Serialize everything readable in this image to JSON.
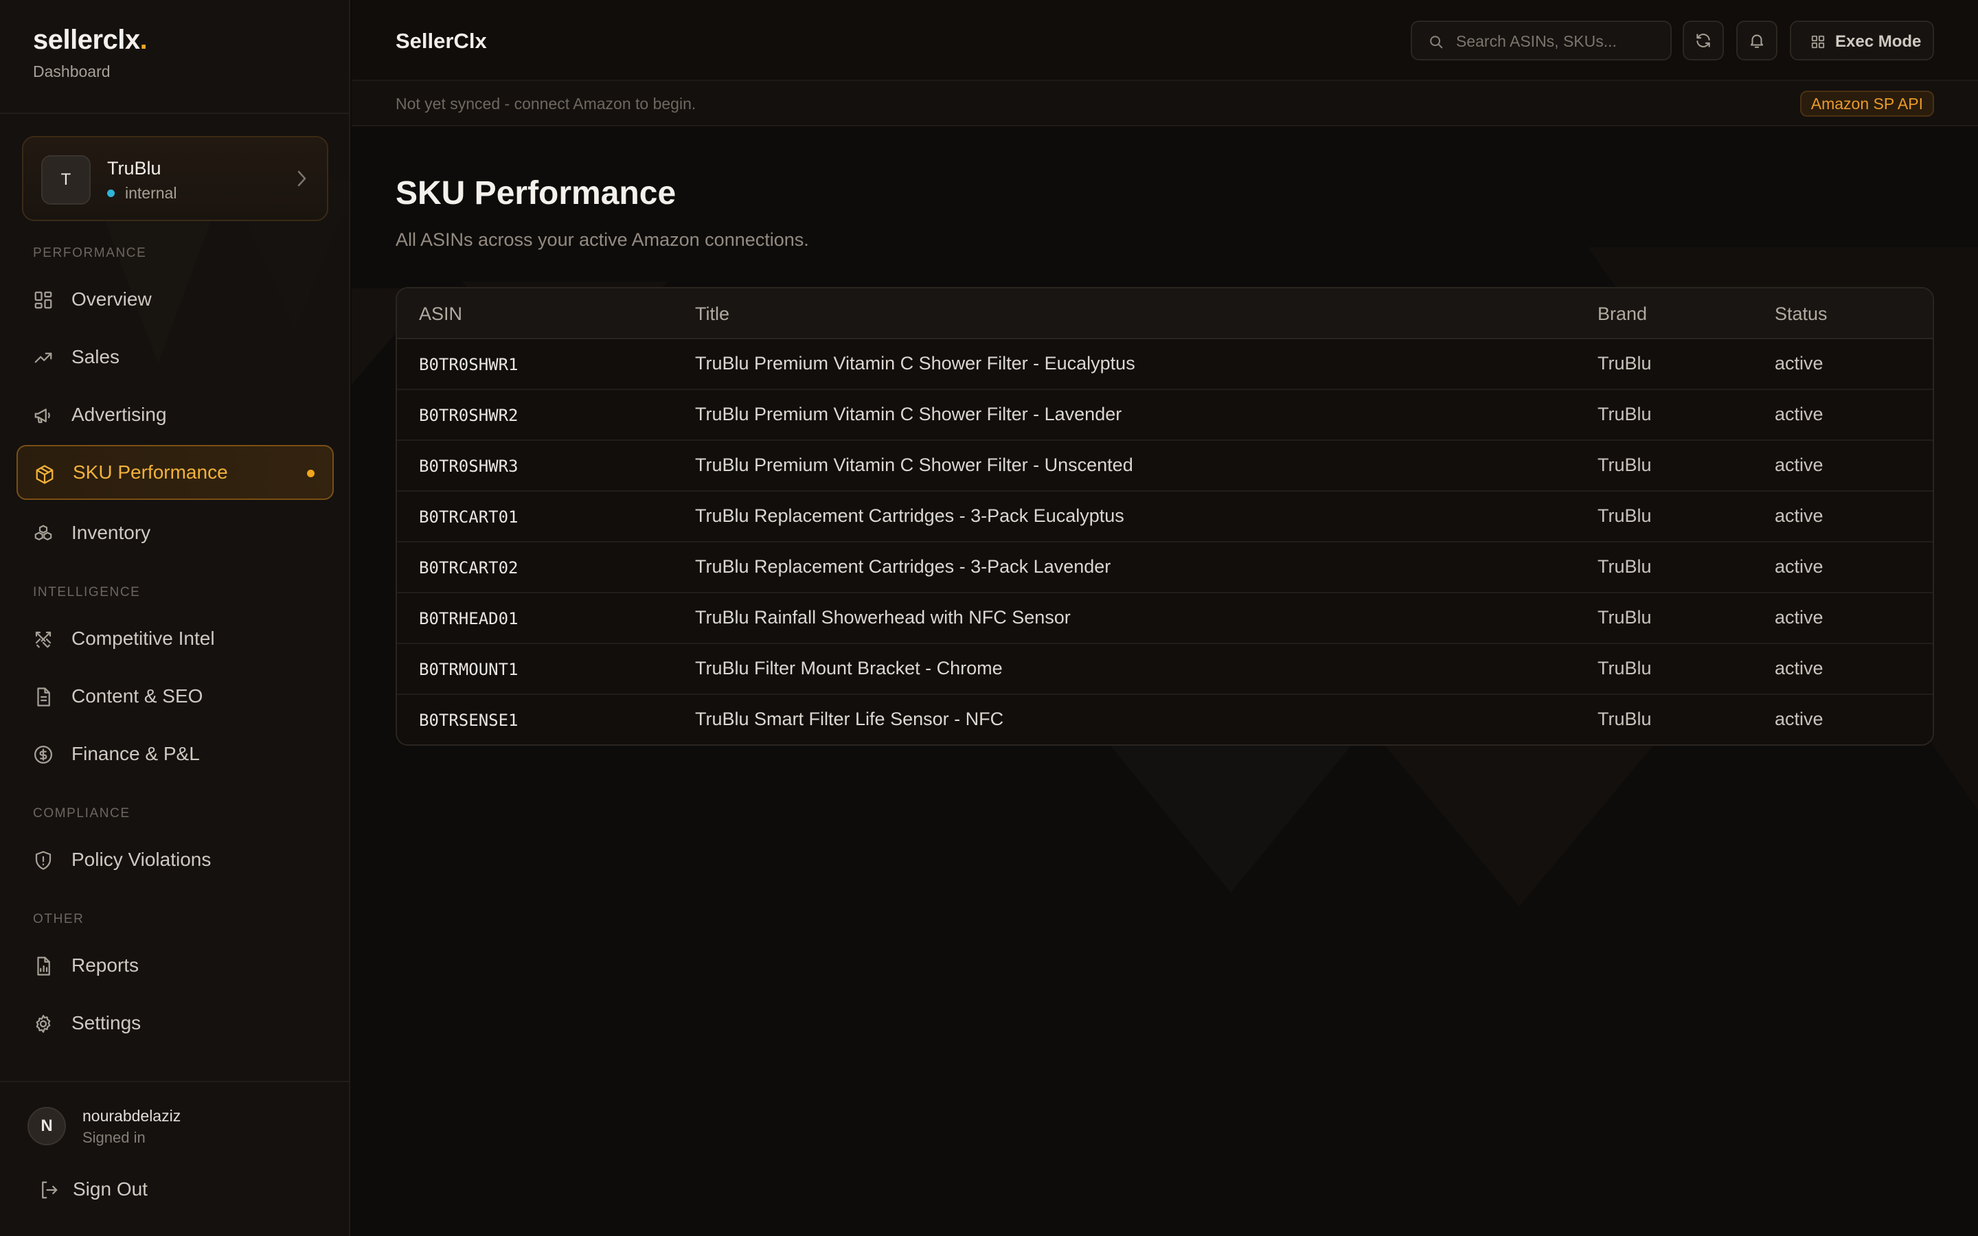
{
  "sidebar": {
    "brand": {
      "name": "sellerclx",
      "dot": ".",
      "subtitle": "Dashboard"
    },
    "org": {
      "initial": "T",
      "name": "TruBlu",
      "status": "internal"
    },
    "sections": {
      "performance": "PERFORMANCE",
      "intelligence": "INTELLIGENCE",
      "compliance": "COMPLIANCE",
      "other": "OTHER"
    },
    "items": [
      {
        "label": "Overview",
        "icon": "grid-icon"
      },
      {
        "label": "Sales",
        "icon": "trending-up-icon"
      },
      {
        "label": "Advertising",
        "icon": "megaphone-icon"
      },
      {
        "label": "SKU Performance",
        "icon": "package-icon",
        "active": true
      },
      {
        "label": "Inventory",
        "icon": "boxes-icon"
      },
      {
        "label": "Competitive Intel",
        "icon": "swords-icon"
      },
      {
        "label": "Content & SEO",
        "icon": "document-icon"
      },
      {
        "label": "Finance & P&L",
        "icon": "dollar-circle-icon"
      },
      {
        "label": "Policy Violations",
        "icon": "shield-alert-icon"
      },
      {
        "label": "Reports",
        "icon": "report-icon"
      },
      {
        "label": "Settings",
        "icon": "gear-icon"
      }
    ],
    "user": {
      "initial": "N",
      "name": "nourabdelaziz",
      "state": "Signed in"
    },
    "signout": "Sign Out"
  },
  "header": {
    "title": "SellerClx",
    "search_placeholder": "Search ASINs, SKUs...",
    "exec_mode": "Exec Mode"
  },
  "syncbar": {
    "message": "Not yet synced - connect Amazon to begin.",
    "badge": "Amazon SP API"
  },
  "page": {
    "title": "SKU Performance",
    "subtitle": "All ASINs across your active Amazon connections."
  },
  "table": {
    "columns": [
      "ASIN",
      "Title",
      "Brand",
      "Status"
    ],
    "rows": [
      {
        "asin": "B0TR0SHWR1",
        "title": "TruBlu Premium Vitamin C Shower Filter - Eucalyptus",
        "brand": "TruBlu",
        "status": "active"
      },
      {
        "asin": "B0TR0SHWR2",
        "title": "TruBlu Premium Vitamin C Shower Filter - Lavender",
        "brand": "TruBlu",
        "status": "active"
      },
      {
        "asin": "B0TR0SHWR3",
        "title": "TruBlu Premium Vitamin C Shower Filter - Unscented",
        "brand": "TruBlu",
        "status": "active"
      },
      {
        "asin": "B0TRCART01",
        "title": "TruBlu Replacement Cartridges - 3-Pack Eucalyptus",
        "brand": "TruBlu",
        "status": "active"
      },
      {
        "asin": "B0TRCART02",
        "title": "TruBlu Replacement Cartridges - 3-Pack Lavender",
        "brand": "TruBlu",
        "status": "active"
      },
      {
        "asin": "B0TRHEAD01",
        "title": "TruBlu Rainfall Showerhead with NFC Sensor",
        "brand": "TruBlu",
        "status": "active"
      },
      {
        "asin": "B0TRMOUNT1",
        "title": "TruBlu Filter Mount Bracket - Chrome",
        "brand": "TruBlu",
        "status": "active"
      },
      {
        "asin": "B0TRSENSE1",
        "title": "TruBlu Smart Filter Life Sensor - NFC",
        "brand": "TruBlu",
        "status": "active"
      }
    ]
  },
  "colors": {
    "accent": "#f2a71b",
    "background": "#0e0c0a",
    "sidebar": "#14110f",
    "status_dot": "#2fb4d9"
  }
}
